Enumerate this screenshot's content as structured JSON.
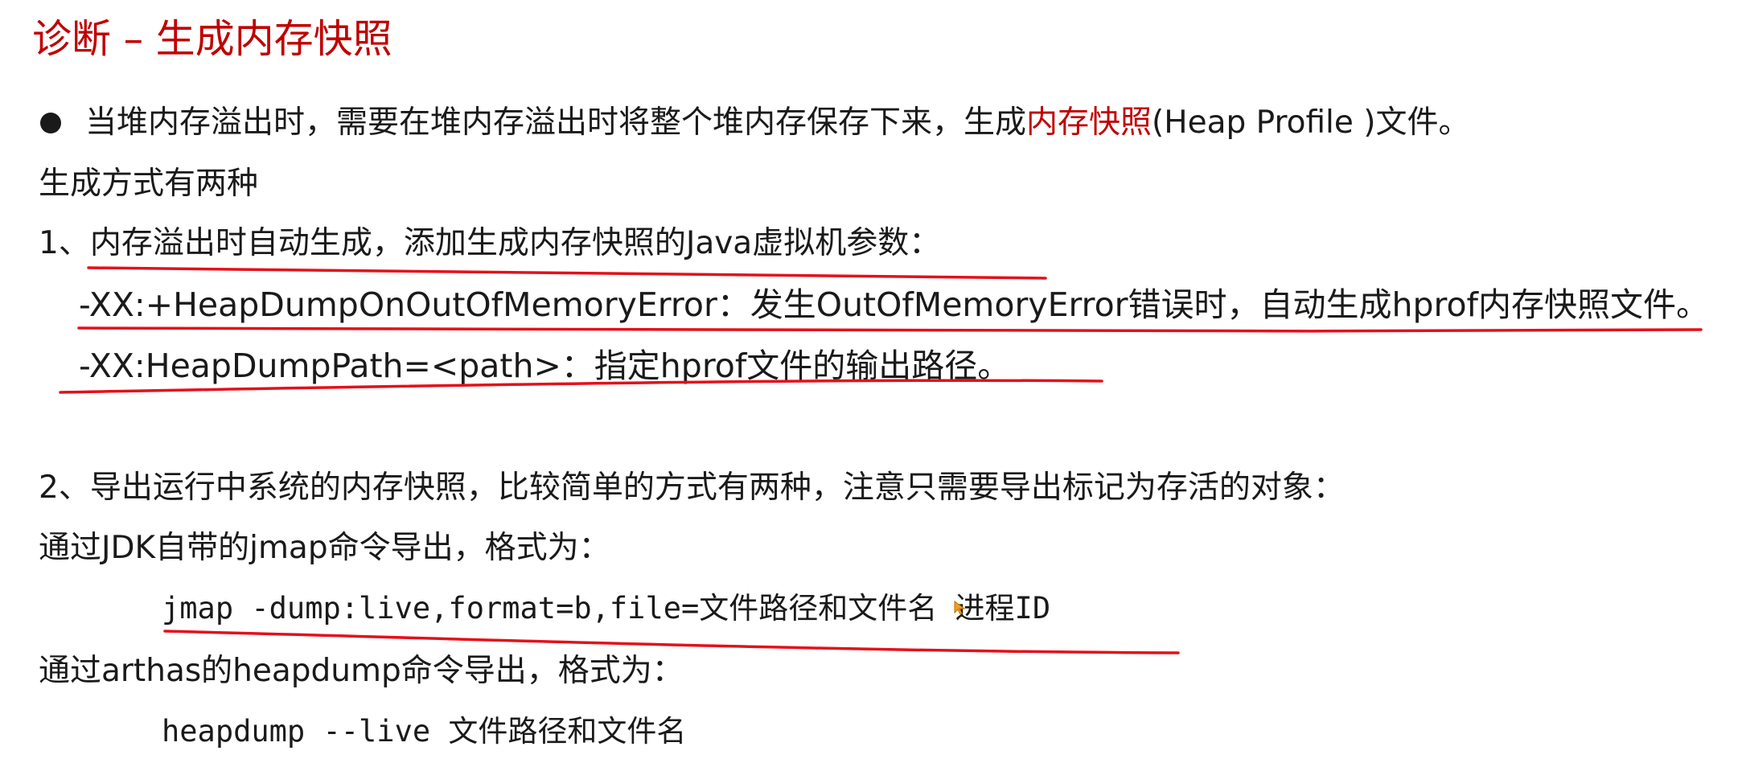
{
  "title": "诊断 – 生成内存快照",
  "bullet": {
    "before": "当堆内存溢出时，需要在堆内存溢出时将整个堆内存保存下来，生成",
    "highlight": "内存快照",
    "after": "(Heap Profile )文件。"
  },
  "intro": "生成方式有两种",
  "method1": {
    "heading": "1、内存溢出时自动生成，添加生成内存快照的Java虚拟机参数：",
    "option1": "-XX:+HeapDumpOnOutOfMemoryError：发生OutOfMemoryError错误时，自动生成hprof内存快照文件。",
    "option2": "-XX:HeapDumpPath=<path>：指定hprof文件的输出路径。"
  },
  "method2": {
    "heading": "2、导出运行中系统的内存快照，比较简单的方式有两种，注意只需要导出标记为存活的对象：",
    "jmap_intro": "通过JDK自带的jmap命令导出，格式为：",
    "jmap_cmd": "jmap -dump:live,format=b,file=文件路径和文件名 进程ID",
    "arthas_intro": "通过arthas的heapdump命令导出，格式为：",
    "arthas_cmd": "heapdump --live   文件路径和文件名"
  },
  "colors": {
    "title": "#c00000",
    "highlight": "#c00000",
    "annotation": "#e4101a",
    "cursor": "#f0a020"
  }
}
